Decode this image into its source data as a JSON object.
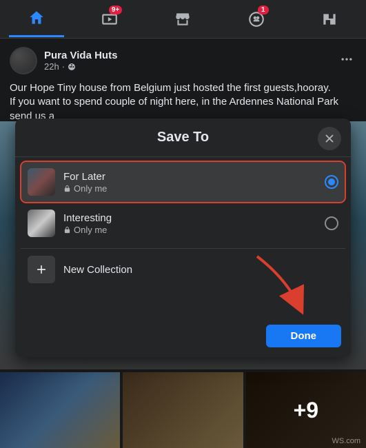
{
  "nav": {
    "home": "home",
    "watch": {
      "name": "watch",
      "badge": "9+"
    },
    "marketplace": "marketplace",
    "groups": {
      "name": "groups",
      "badge": "1"
    },
    "gaming": "gaming"
  },
  "post": {
    "author": "Pura Vida Huts",
    "time": "22h",
    "audience": "public",
    "more": "...",
    "text_line1": "Our Hope Tiny house from Belgium just hosted the first guests,hooray.",
    "text_line2": "If you want to spend couple of night here, in the Ardennes National Park send us a",
    "more_count": "+9"
  },
  "modal": {
    "title": "Save To",
    "collections": [
      {
        "name": "For Later",
        "privacy": "Only me",
        "selected": true
      },
      {
        "name": "Interesting",
        "privacy": "Only me",
        "selected": false
      }
    ],
    "new_collection_label": "New Collection",
    "done_label": "Done"
  },
  "watermark": "WS.com"
}
